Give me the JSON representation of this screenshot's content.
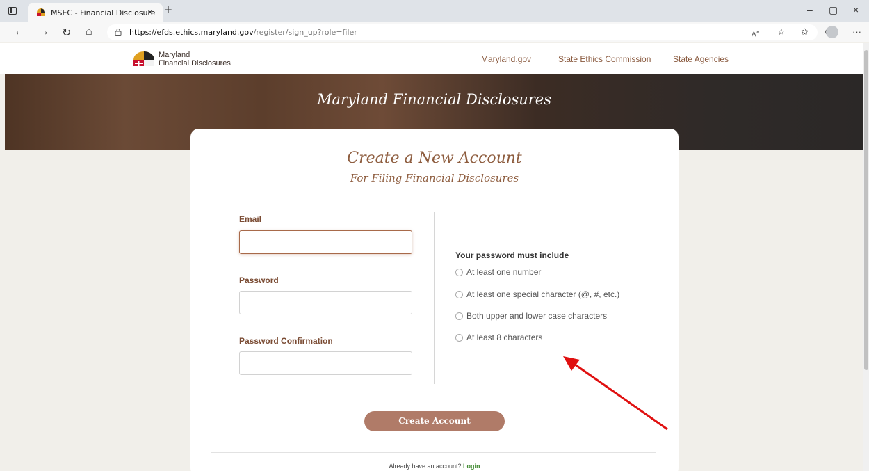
{
  "browser": {
    "tab_title": "MSEC - Financial Disclosure",
    "tab_close": "×",
    "new_tab": "+",
    "url_domain": "https://efds.ethics.maryland.gov",
    "url_path": "/register/sign_up?role=filer",
    "window_controls": [
      "–",
      "▢",
      "×"
    ],
    "icons": [
      "back-icon",
      "forward-icon",
      "refresh-icon",
      "home-icon",
      "lock-icon",
      "read-aloud-icon",
      "favorite-icon",
      "favorites-list-icon",
      "collections-icon",
      "profile-icon",
      "more-icon"
    ]
  },
  "header": {
    "logo_line1": "Maryland",
    "logo_line2": "Financial Disclosures",
    "nav": [
      "Maryland.gov",
      "State Ethics Commission",
      "State Agencies"
    ]
  },
  "hero": {
    "title": "Maryland Financial Disclosures"
  },
  "form": {
    "title": "Create a New Account",
    "subtitle": "For Filing Financial Disclosures",
    "email_label": "Email",
    "email_value": "",
    "password_label": "Password",
    "password_value": "",
    "confirm_label": "Password Confirmation",
    "confirm_value": "",
    "requirements_title": "Your password must include",
    "requirements": [
      "At least one number",
      "At least one special character (@, #, etc.)",
      "Both upper and lower case characters",
      "At least 8 characters"
    ],
    "submit_label": "Create Account",
    "login_prompt": "Already have an account?",
    "login_link": "Login"
  },
  "colors": {
    "brand_brown": "#8e5d3f",
    "button": "#b07b68",
    "login_link": "#3f8a2f",
    "annotation_arrow": "#e01010"
  }
}
